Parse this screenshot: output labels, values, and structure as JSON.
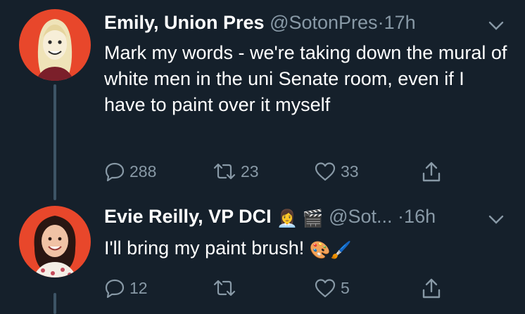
{
  "tweets": [
    {
      "name": "Emily, Union Pres",
      "handle": "@SotonPres",
      "separator": "·",
      "time": "17h",
      "text": "Mark my words - we're taking down the mural of white men in the uni Senate room, even if I have to paint over it myself",
      "counts": {
        "reply": "288",
        "retweet": "23",
        "like": "33"
      }
    },
    {
      "name": "Evie Reilly, VP DCI",
      "name_emojis": "👩‍💼 🎬",
      "handle": "@Sot...",
      "separator": "·",
      "time": "16h",
      "text": "I'll bring my paint brush!",
      "text_emojis": "🎨🖌️",
      "counts": {
        "reply": "12",
        "retweet": "",
        "like": "5"
      }
    }
  ],
  "colors": {
    "background": "#15202b",
    "text": "#ffffff",
    "muted": "#8899a6",
    "thread_line": "#3d5466",
    "avatar_bg": "#e8472b"
  },
  "icons": [
    "reply-icon",
    "retweet-icon",
    "like-icon",
    "share-icon",
    "chevron-down-icon"
  ]
}
